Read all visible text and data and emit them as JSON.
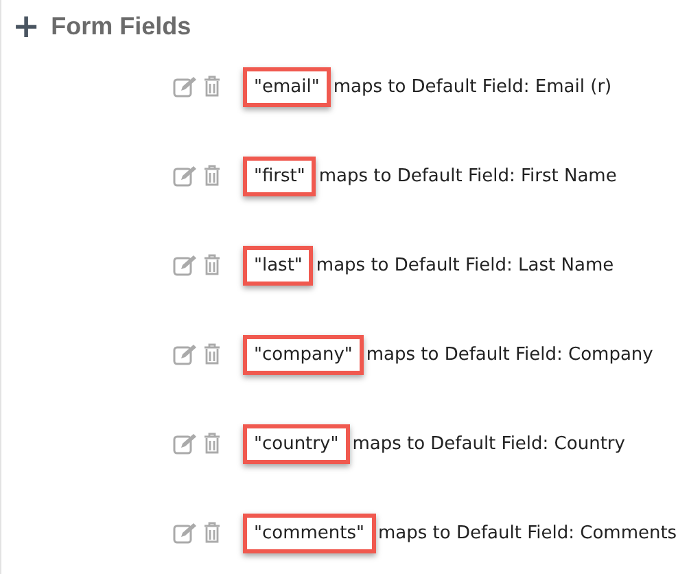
{
  "section": {
    "icon": "+",
    "title": "Form Fields"
  },
  "fields": [
    {
      "name": "\"email\"",
      "mapping": "maps to Default Field: Email (r)",
      "highlighted": true
    },
    {
      "name": "\"first\"",
      "mapping": "maps to Default Field: First Name",
      "highlighted": true
    },
    {
      "name": "\"last\"",
      "mapping": "maps to Default Field: Last Name",
      "highlighted": true
    },
    {
      "name": "\"company\"",
      "mapping": "maps to Default Field: Company",
      "highlighted": true
    },
    {
      "name": "\"country\"",
      "mapping": "maps to Default Field: Country",
      "highlighted": true
    },
    {
      "name": "\"comments\"",
      "mapping": "maps to Default Field: Comments",
      "highlighted": true
    }
  ]
}
